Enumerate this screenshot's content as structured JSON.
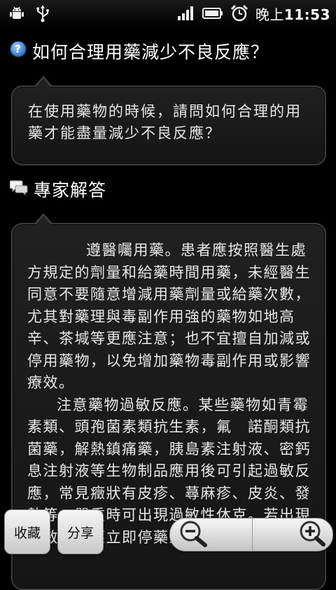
{
  "status_bar": {
    "time_period": "晚上",
    "time": "11:53",
    "icons": [
      "android-debug-icon",
      "usb-icon",
      "signal-icon",
      "battery-icon",
      "alarm-icon"
    ]
  },
  "question": {
    "title": "如何合理用藥減少不良反應？",
    "body": "在使用藥物的時候，請問如何合理的用藥才能盡量減少不良反應？"
  },
  "answer": {
    "heading": "專家解答",
    "paragraph_1": "遵醫囑用藥。患者應按照醫生處方規定的劑量和給藥時間用藥，未經醫生同意不要隨意增減用藥劑量或給藥次數，尤其對藥理與毒副作用強的藥物如地高辛、茶堿等更應注意；也不宜擅自加減或停用藥物，以免增加藥物毒副作用或影響療效。",
    "paragraph_2": "注意藥物過敏反應。某些藥物如青霉素類、頭孢菌素類抗生素，氟　諾酮類抗菌藥，解熱鎮痛藥，胰島素注射液、密鈣息注射液等生物制品應用後可引起過敏反應，常見癥狀有皮疹、蕁麻疹、皮炎、發熱等，嚴重時可出現過敏性休克。若出現過敏反應應立即停藥並就醫。"
  },
  "bottom_bar": {
    "favorite_label": "收藏",
    "share_label": "分享"
  },
  "colors": {
    "background": "#000000",
    "bubble": "#1c1c1c",
    "bubble_border": "#3c3c3c",
    "question_icon": "#3a8fd8",
    "button": "#e6e6e6"
  }
}
